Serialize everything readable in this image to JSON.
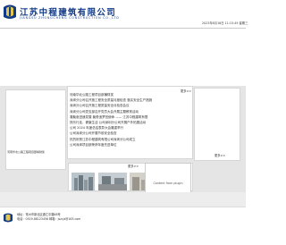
{
  "header": {
    "company_cn": "江苏中程建筑有限公司",
    "company_en": "JIANGSU ZHONGCHENG CONSTRUCTION CO.,LTD",
    "datetime": "2023年8月16日 11:15:49 星期三",
    "brand_color": "#123b87"
  },
  "news": {
    "more_label": "更多>>",
    "items": [
      "河南华北公路工程项目部横财奖",
      "深圳分公司召开施工程安全质量月度检查 落实安全生产措施",
      "深圳分公司召开施工程质量安全月检查会议",
      "深圳分公司党支部召开党员大会开展主题教育活动",
      "凝聚奋进速发展 聚势追梦担使命 —— 江苏中程建筑有限",
      "快乐行走，健康生活 公司深圳分公司开展户外拓展活动",
      "公司 2024 年度总结表彰大会隆重举行",
      "公司深圳分公司开展节前安全检查",
      "热烈祝贺江苏中程建筑有限公司深圳分公司成立",
      "公司深圳项目部荣获年度先进单位"
    ]
  },
  "left_panel": {
    "caption": "河南华北公路工程项目部横财奖"
  },
  "right_panel": {
    "more_label": "更多>>"
  },
  "gallery": {
    "more_label": "更多>>",
    "placeholder_text": "Content from plugin"
  },
  "footer": {
    "address": "地址：常州市新北区通江中路88号",
    "phone": "电话：0519-88123456  邮箱：jszcjz@163.com"
  }
}
